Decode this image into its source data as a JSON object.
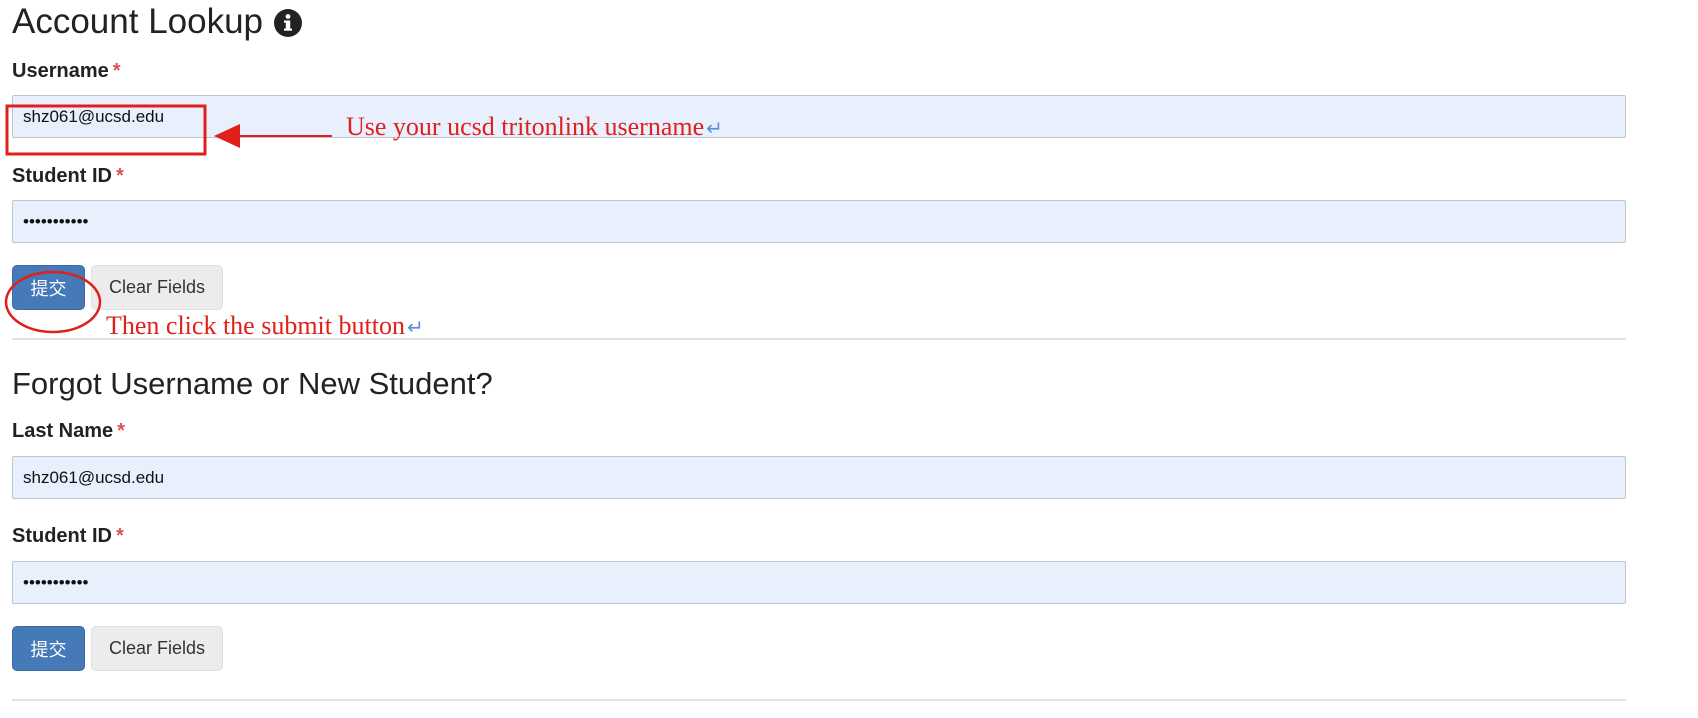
{
  "account_lookup": {
    "title": "Account Lookup",
    "info_icon": "info-circle-icon",
    "username_label": "Username",
    "username_value": "shz061@ucsd.edu",
    "student_id_label": "Student ID",
    "student_id_value": "•••••••••••",
    "submit_label": "提交",
    "clear_label": "Clear Fields"
  },
  "forgot_section": {
    "title": "Forgot Username or New Student?",
    "last_name_label": "Last Name",
    "last_name_value": "shz061@ucsd.edu",
    "student_id_label": "Student ID",
    "student_id_value": "•••••••••••",
    "submit_label": "提交",
    "clear_label": "Clear Fields"
  },
  "required_marker": "*",
  "annotations": {
    "username_hint": "Use your ucsd tritonlink username",
    "submit_hint": "Then click the submit button",
    "return_glyph": "↵",
    "annotation_color": "#e0201b"
  },
  "colors": {
    "field_background": "#e8f0fe",
    "primary_button": "#4679b7",
    "required": "#d9534f"
  }
}
